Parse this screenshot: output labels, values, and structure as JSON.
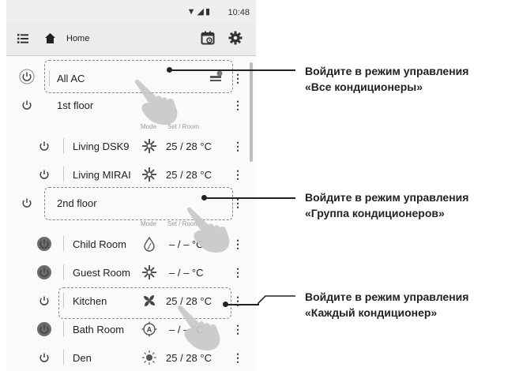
{
  "status_bar": {
    "time": "10:48"
  },
  "app_bar": {
    "title": "Home"
  },
  "list": {
    "all_ac": {
      "label": "All AC"
    },
    "floor1": {
      "label": "1st floor",
      "col_mode": "Mode",
      "col_set_room": "Set / Room"
    },
    "floor1_rooms": [
      {
        "name": "Living DSK9",
        "mode_icon": "heat-icon",
        "temp": "25 / 28 °C",
        "power": "off"
      },
      {
        "name": "Living MIRAI",
        "mode_icon": "heat-icon",
        "temp": "25 / 28 °C",
        "power": "off"
      }
    ],
    "floor2": {
      "label": "2nd floor",
      "col_mode": "Mode",
      "col_set_room": "Set / Room"
    },
    "floor2_rooms": [
      {
        "name": "Child Room",
        "mode_icon": "dry-icon",
        "temp": "– / –  °C",
        "power": "on"
      },
      {
        "name": "Guest Room",
        "mode_icon": "heat-icon",
        "temp": "– / –  °C",
        "power": "on"
      },
      {
        "name": "Kitchen",
        "mode_icon": "fan-icon",
        "temp": "25 / 28 °C",
        "power": "off"
      },
      {
        "name": "Bath Room",
        "mode_icon": "auto-icon",
        "temp": "– / –  °C",
        "power": "on"
      },
      {
        "name": "Den",
        "mode_icon": "sun-icon",
        "temp": "25 / 28 °C",
        "power": "off"
      }
    ]
  },
  "callouts": [
    {
      "line1": "Войдите в режим управления",
      "line2": "«Все кондиционеры»"
    },
    {
      "line1": "Войдите в режим управления",
      "line2": "«Группа кондиционеров»"
    },
    {
      "line1": "Войдите в режим управления",
      "line2": "«Каждый кондиционер»"
    }
  ],
  "colors": {
    "power_on": "#6b6b6b",
    "power_off": "#555555",
    "accent": "#222222"
  }
}
